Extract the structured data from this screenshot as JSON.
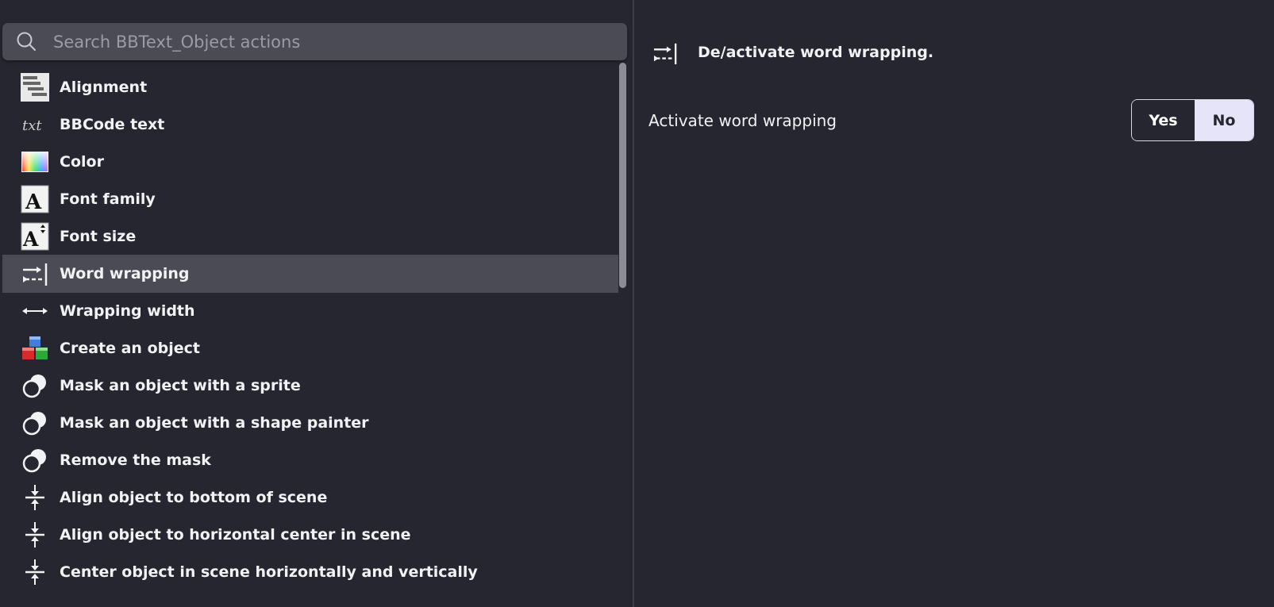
{
  "search": {
    "placeholder": "Search BBText_Object actions",
    "value": ""
  },
  "actions": [
    {
      "label": "Alignment",
      "icon": "alignment-icon"
    },
    {
      "label": "BBCode text",
      "icon": "txt-icon"
    },
    {
      "label": "Color",
      "icon": "color-gradient-icon"
    },
    {
      "label": "Font family",
      "icon": "font-family-icon"
    },
    {
      "label": "Font size",
      "icon": "font-size-icon"
    },
    {
      "label": "Word wrapping",
      "icon": "word-wrap-icon",
      "selected": true
    },
    {
      "label": "Wrapping width",
      "icon": "width-arrow-icon"
    },
    {
      "label": "Create an object",
      "icon": "create-object-icon"
    },
    {
      "label": "Mask an object with a sprite",
      "icon": "mask-icon"
    },
    {
      "label": "Mask an object with a shape painter",
      "icon": "mask-icon"
    },
    {
      "label": "Remove the mask",
      "icon": "mask-icon"
    },
    {
      "label": "Align object to bottom of scene",
      "icon": "align-center-icon"
    },
    {
      "label": "Align object to horizontal center in scene",
      "icon": "align-center-icon"
    },
    {
      "label": "Center object in scene horizontally and vertically",
      "icon": "align-center-icon"
    }
  ],
  "detail": {
    "description": "De/activate word wrapping.",
    "parameter_label": "Activate word wrapping",
    "yes_label": "Yes",
    "no_label": "No",
    "selected_option": "No"
  },
  "colors": {
    "background": "#25262f",
    "selected_row": "#4a4b55",
    "toggle_active": "#e6e4f8"
  }
}
